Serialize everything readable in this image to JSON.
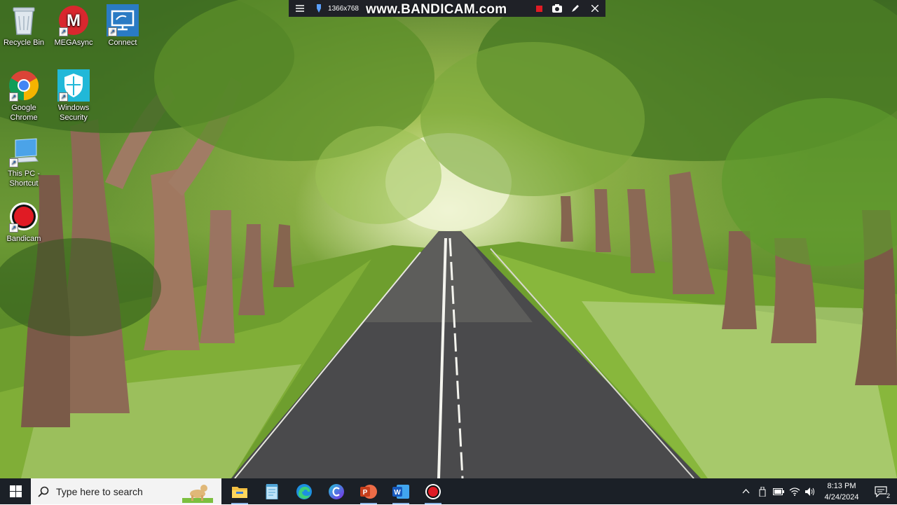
{
  "desktop": {
    "icons": [
      {
        "label": "Recycle Bin",
        "icon": "recycle-bin-icon"
      },
      {
        "label": "MEGAsync",
        "icon": "megasync-icon"
      },
      {
        "label": "Connect",
        "icon": "connect-icon"
      },
      {
        "label": "Google Chrome",
        "icon": "chrome-icon"
      },
      {
        "label": "Windows Security",
        "icon": "windows-security-icon"
      },
      {
        "label": "This PC - Shortcut",
        "icon": "this-pc-icon"
      },
      {
        "label": "Bandicam",
        "icon": "bandicam-icon"
      }
    ]
  },
  "recorder": {
    "resolution": "1366x768",
    "watermark": "www.BANDICAM.com"
  },
  "taskbar": {
    "search_placeholder": "Type here to search",
    "apps": [
      {
        "name": "File Explorer",
        "icon": "file-explorer-icon"
      },
      {
        "name": "Notepad",
        "icon": "notepad-icon"
      },
      {
        "name": "Microsoft Edge",
        "icon": "edge-icon"
      },
      {
        "name": "Canva",
        "icon": "canva-icon"
      },
      {
        "name": "PowerPoint",
        "icon": "powerpoint-icon"
      },
      {
        "name": "Word",
        "icon": "word-icon"
      },
      {
        "name": "Bandicam",
        "icon": "bandicam-icon"
      }
    ],
    "clock": {
      "time": "8:13 PM",
      "date": "4/24/2024"
    },
    "notification_count": "2"
  },
  "colors": {
    "taskbar": "#1b2027",
    "accent": "#8fb8e8"
  }
}
